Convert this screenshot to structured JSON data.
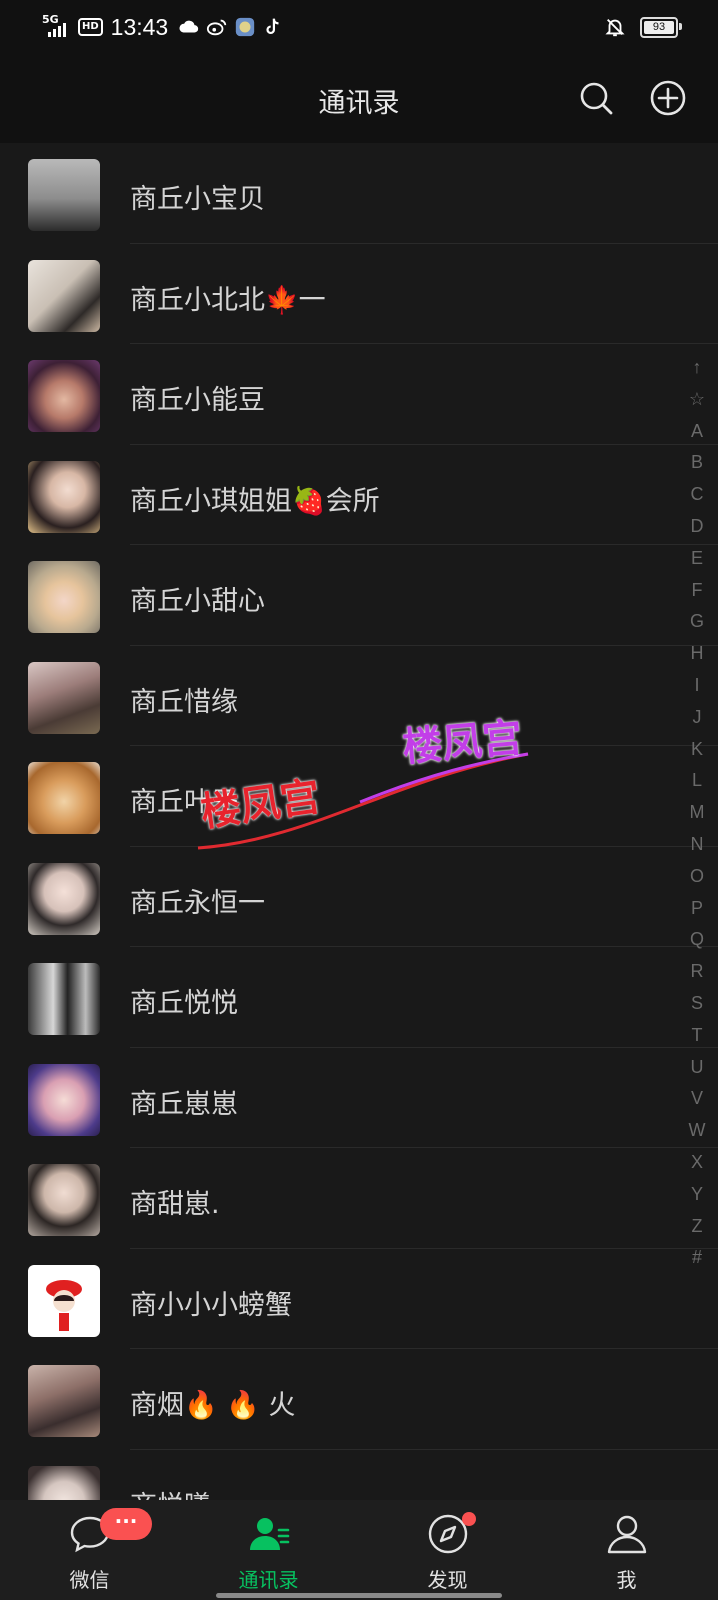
{
  "status_bar": {
    "network": "5G",
    "hd": "HD",
    "time": "13:43",
    "battery": "93",
    "icons": [
      "cloud-icon",
      "weibo-icon",
      "app-icon",
      "tiktok-icon",
      "mute-bell-icon"
    ]
  },
  "header": {
    "title": "通讯录",
    "search_icon": "search-icon",
    "add_icon": "add-circle-icon"
  },
  "contacts": [
    {
      "name": "商丘小宝贝"
    },
    {
      "name": "商丘小北北🍁一"
    },
    {
      "name": "商丘小能豆"
    },
    {
      "name": "商丘小琪姐姐🍓会所"
    },
    {
      "name": "商丘小甜心"
    },
    {
      "name": "商丘惜缘"
    },
    {
      "name": "商丘叶子"
    },
    {
      "name": "商丘永恒一"
    },
    {
      "name": "商丘悦悦"
    },
    {
      "name": "商丘崽崽"
    },
    {
      "name": "商甜崽."
    },
    {
      "name": "商小小小螃蟹"
    },
    {
      "name": "商烟🔥 🔥 火"
    },
    {
      "name": "商悦曦"
    }
  ],
  "index_letters": [
    "↑",
    "☆",
    "A",
    "B",
    "C",
    "D",
    "E",
    "F",
    "G",
    "H",
    "I",
    "J",
    "K",
    "L",
    "M",
    "N",
    "O",
    "P",
    "Q",
    "R",
    "S",
    "T",
    "U",
    "V",
    "W",
    "X",
    "Y",
    "Z",
    "#"
  ],
  "watermark": {
    "text1": "楼凤宫",
    "text2": "楼凤宫"
  },
  "tabs": [
    {
      "label": "微信",
      "icon": "chat-bubble-icon",
      "badge": "···"
    },
    {
      "label": "通讯录",
      "icon": "contacts-icon"
    },
    {
      "label": "发现",
      "icon": "compass-icon"
    },
    {
      "label": "我",
      "icon": "person-icon"
    }
  ],
  "colors": {
    "accent": "#07c160",
    "badge": "#fa5151",
    "background": "#191919"
  }
}
